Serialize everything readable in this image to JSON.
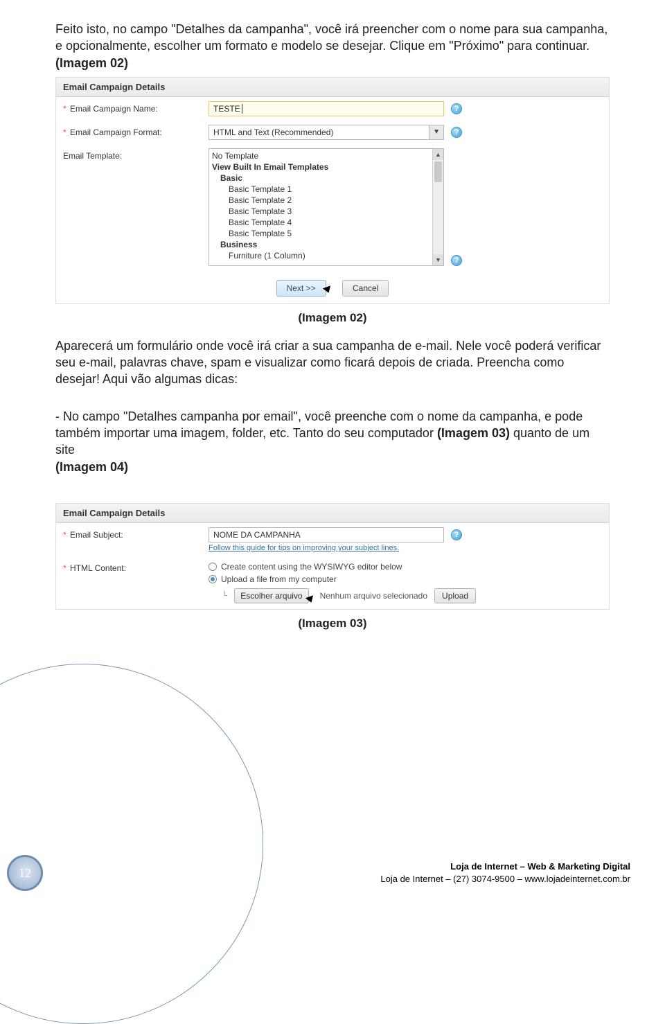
{
  "intro": {
    "p1a": "Feito isto, no campo \"Detalhes da campanha\", você irá preencher com o nome para sua campanha, e opcionalmente, escolher um formato e modelo se desejar. Clique em \"Próximo\" para continuar.",
    "p1b": "(Imagem 02)"
  },
  "shot1": {
    "header": "Email Campaign Details",
    "row_name_label": "Email Campaign Name:",
    "row_name_value": "TESTE",
    "row_format_label": "Email Campaign Format:",
    "row_format_value": "HTML and Text (Recommended)",
    "row_template_label": "Email Template:",
    "templates": {
      "none": "No Template",
      "view": "View Built In Email Templates",
      "cat1": "Basic",
      "c1_1": "Basic Template 1",
      "c1_2": "Basic Template 2",
      "c1_3": "Basic Template 3",
      "c1_4": "Basic Template 4",
      "c1_5": "Basic Template 5",
      "cat2": "Business",
      "c2_1": "Furniture (1 Column)"
    },
    "btn_next": "Next >>",
    "btn_cancel": "Cancel",
    "caption": "(Imagem 02)"
  },
  "mid": {
    "p2": "Aparecerá um formulário onde você irá criar a sua campanha de e-mail. Nele você poderá verificar seu e-mail, palavras chave, spam e visualizar como ficará depois de criada. Preencha como desejar! Aqui vão algumas dicas:",
    "p3a": "- No campo \"Detalhes campanha por email\", você preenche com o nome da campanha, e pode também importar uma imagem, folder, etc. Tanto do seu computador ",
    "p3b": "(Imagem 03)",
    "p3c": " quanto de um site ",
    "p3d": "(Imagem 04)"
  },
  "shot2": {
    "header": "Email Campaign Details",
    "row_subject_label": "Email Subject:",
    "row_subject_value": "NOME DA CAMPANHA",
    "subject_tip": "Follow this guide for tips on improving your subject lines.",
    "row_html_label": "HTML Content:",
    "opt_wysiwyg": "Create content using the WYSIWYG editor below",
    "opt_upload": "Upload a file from my computer",
    "btn_choose": "Escolher arquivo",
    "no_file": "Nenhum arquivo selecionado",
    "btn_upload": "Upload",
    "caption": "(Imagem 03)"
  },
  "footer": {
    "page": "12",
    "line1": "Loja de Internet – Web & Marketing Digital",
    "line2": "Loja de Internet – (27) 3074-9500 – www.lojadeinternet.com.br"
  },
  "icons": {
    "help": "?"
  }
}
